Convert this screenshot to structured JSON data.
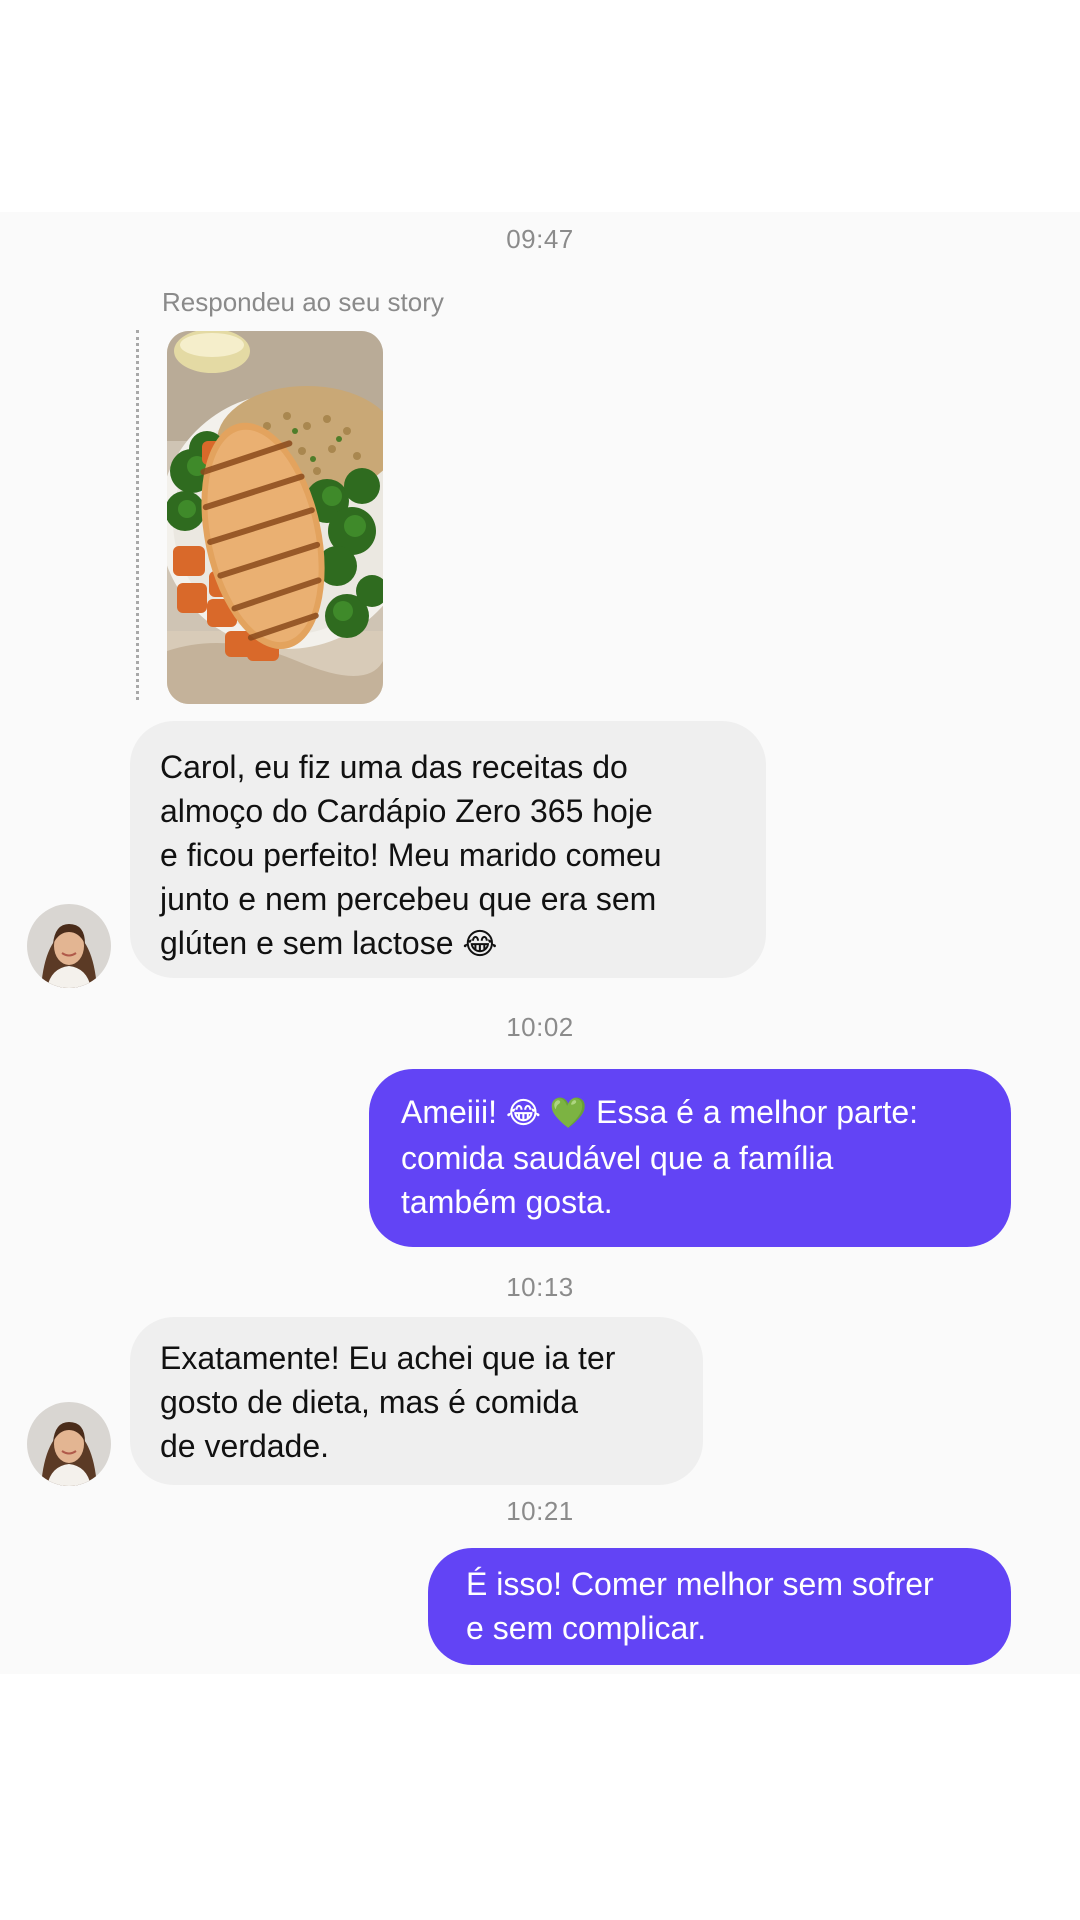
{
  "conversation": {
    "timestamps": [
      "09:47",
      "10:02",
      "10:13",
      "10:21"
    ],
    "story_reply": {
      "caption": "Respondeu ao seu story"
    },
    "messages": [
      {
        "from": "contact",
        "lines": [
          "Carol, eu fiz uma das receitas do",
          "almoço do Cardápio Zero 365 hoje",
          "e ficou perfeito! Meu marido comeu",
          "junto e nem percebeu que era sem",
          "glúten e sem lactose"
        ],
        "emoji": "😂"
      },
      {
        "from": "me",
        "first_line_start": "Ameiii!",
        "emoji_1": "😂",
        "emoji_2": "💚",
        "first_line_end": "Essa é a melhor parte:",
        "lines": [
          "comida saudável que a família",
          "também gosta."
        ]
      },
      {
        "from": "contact",
        "lines": [
          "Exatamente! Eu achei que ia ter",
          "gosto de dieta, mas é comida",
          "de verdade."
        ]
      },
      {
        "from": "me",
        "lines": [
          "É isso! Comer melhor sem sofrer",
          "e sem complicar."
        ]
      }
    ]
  },
  "colors": {
    "sent_bubble": "#6244f5",
    "received_bubble": "#efefef",
    "chat_background": "#fafafa",
    "timestamp_text": "#8b8b8b"
  },
  "icons": {
    "avatar": "woman-portrait-avatar",
    "story_image": "grilled-chicken-quinoa-broccoli-plate"
  }
}
